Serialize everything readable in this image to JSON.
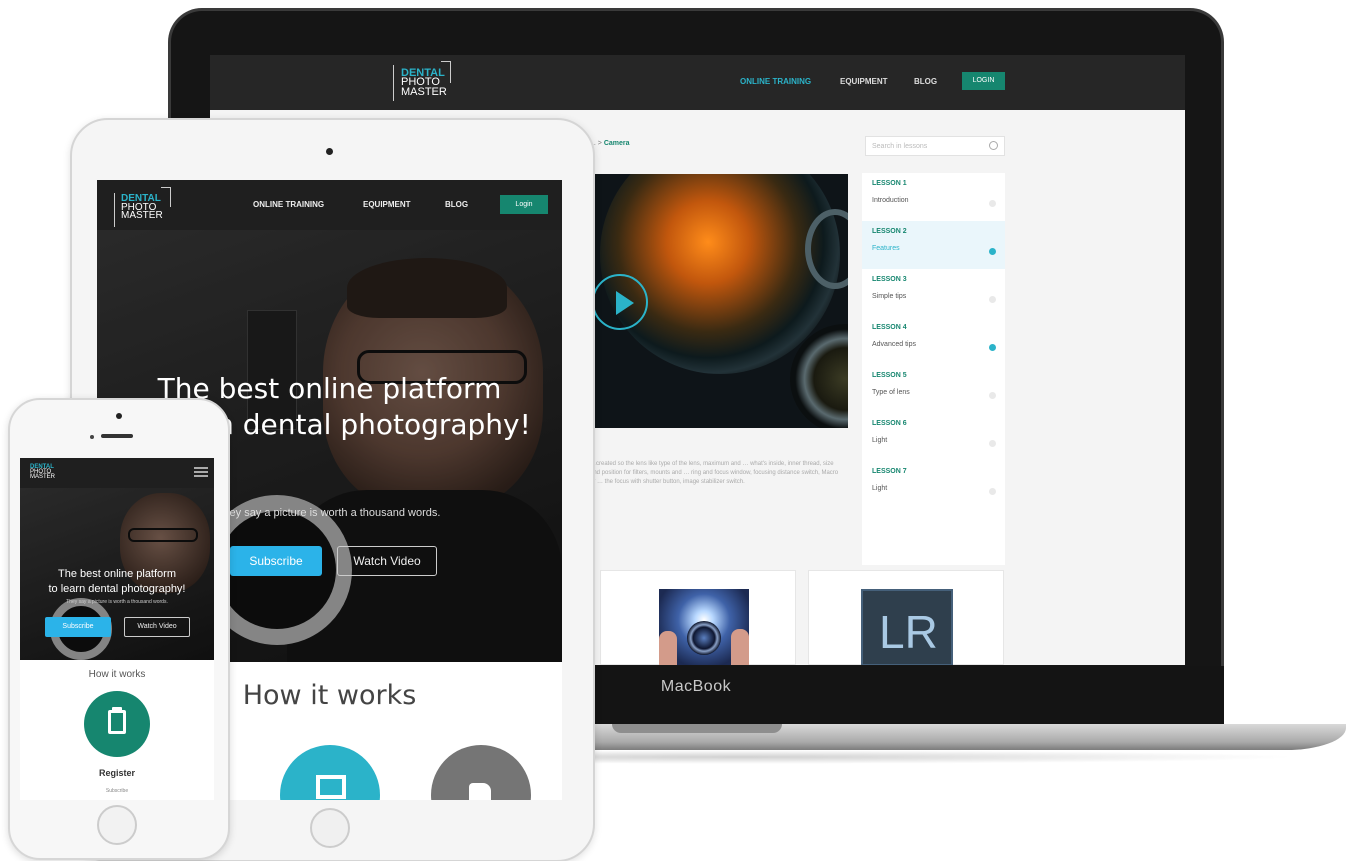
{
  "brand": {
    "logo_line1": "DENTAL",
    "logo_line2": "PHOTO",
    "logo_line3": "MASTER",
    "accent": "#2bb3c9",
    "green": "#16866f"
  },
  "laptop": {
    "device_label": "MacBook",
    "nav": {
      "online_training": "ONLINE TRAINING",
      "equipment": "EQUIPMENT",
      "blog": "BLOG",
      "login": "LOGIN"
    },
    "breadcrumb": {
      "parent": "...",
      "current": "Camera"
    },
    "search": {
      "placeholder": "Search in lessons"
    },
    "video": {
      "play_icon": "play-icon"
    },
    "description": "…created so the lens like type of the lens, maximum and … what's inside, inner thread, size and position for filters, mounts and … ring and focus window, focusing distance switch, Macro or … the focus with shutter button, image stabilizer switch.",
    "lessons": [
      {
        "number": "LESSON 1",
        "title": "Introduction",
        "time": "",
        "done": false
      },
      {
        "number": "LESSON 2",
        "title": "Features",
        "time": "",
        "done": true
      },
      {
        "number": "LESSON 3",
        "title": "Simple tips",
        "time": "",
        "done": false
      },
      {
        "number": "LESSON 4",
        "title": "Advanced tips",
        "time": "",
        "done": true
      },
      {
        "number": "LESSON 5",
        "title": "Type of lens",
        "time": "",
        "done": false
      },
      {
        "number": "LESSON 6",
        "title": "Light",
        "time": "",
        "done": false
      },
      {
        "number": "LESSON 7",
        "title": "Light",
        "time": "",
        "done": false
      }
    ],
    "cards": [
      {
        "label": "LR"
      }
    ]
  },
  "tablet": {
    "nav": {
      "online_training": "ONLINE TRAINING",
      "equipment": "EQUIPMENT",
      "blog": "BLOG",
      "login": "Login"
    },
    "hero": {
      "title_line1": "The best online platform",
      "title_line2": "…n dental photography!",
      "subtitle": "…ey say a picture is worth a thousand words.",
      "subscribe": "Subscribe",
      "watch": "Watch Video"
    },
    "how_it_works": "How it works"
  },
  "phone": {
    "hero": {
      "title_line1": "The best online platform",
      "title_line2": "to learn dental photography!",
      "subtitle": "They say a picture is worth a thousand words.",
      "subscribe": "Subscribe",
      "watch": "Watch Video"
    },
    "how_it_works": "How it works",
    "step_title": "Register",
    "step_sub": "Subscribe"
  }
}
